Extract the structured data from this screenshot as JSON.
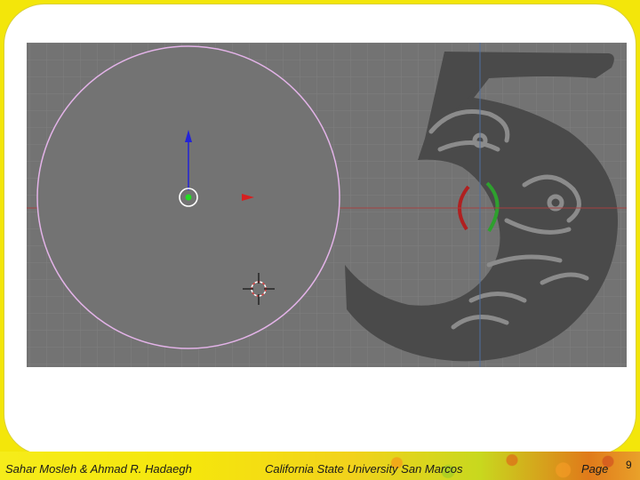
{
  "footer": {
    "authors": "Sahar Mosleh & Ahmad R. Hadaegh",
    "university": "California State University San Marcos",
    "page_label": "Page",
    "page_number": "9"
  },
  "viewport": {
    "background_color": "#737373",
    "grid_color": "#7e7e7e",
    "x_axis_color": "#b33a3a",
    "y_axis_color": "#3b6ea5",
    "circle_outline_color": "#e3b3e8",
    "logo_fill_color": "#4a4a4a"
  },
  "icons": {
    "object_origin": "object-center-icon",
    "transform_arrow_x": "x-arrow-icon",
    "transform_arrow_y": "y-arrow-icon",
    "cursor_3d": "3d-cursor-icon"
  }
}
